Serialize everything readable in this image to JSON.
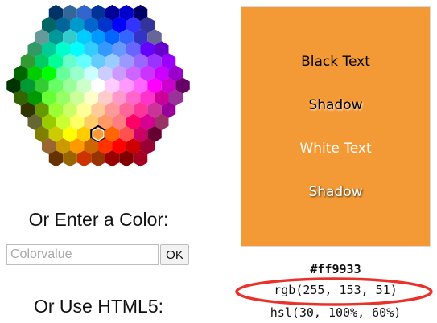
{
  "picker": {
    "selected_color": "#ff9933",
    "palette": [
      "#003366",
      "#336699",
      "#3366CC",
      "#003399",
      "#000099",
      "#0000CC",
      "#000066",
      "#006666",
      "#006699",
      "#0099CC",
      "#0066CC",
      "#0033CC",
      "#0000FF",
      "#3333FF",
      "#333399",
      "#669999",
      "#009999",
      "#33CCCC",
      "#00CCFF",
      "#0099FF",
      "#0066FF",
      "#3366FF",
      "#3333CC",
      "#666699",
      "#339966",
      "#00CC99",
      "#00FFCC",
      "#00FFFF",
      "#33CCFF",
      "#3399FF",
      "#6699FF",
      "#6666FF",
      "#6600FF",
      "#6600CC",
      "#339933",
      "#00CC66",
      "#00FF99",
      "#66FFCC",
      "#66FFFF",
      "#66CCFF",
      "#99CCFF",
      "#9999FF",
      "#9966FF",
      "#9933FF",
      "#9900FF",
      "#006600",
      "#00CC00",
      "#00FF00",
      "#66FF99",
      "#99FFCC",
      "#CCFFFF",
      "#CCCCFF",
      "#CC99FF",
      "#CC66FF",
      "#CC33FF",
      "#CC00FF",
      "#9900CC",
      "#003300",
      "#009933",
      "#33CC33",
      "#66FF66",
      "#99FF99",
      "#CCFFCC",
      "#FFFFFF",
      "#FFCCFF",
      "#FF99FF",
      "#FF66FF",
      "#FF00FF",
      "#CC00CC",
      "#660066",
      "#336600",
      "#009900",
      "#66FF33",
      "#99FF66",
      "#CCFF99",
      "#FFFFCC",
      "#FFCCCC",
      "#FF99CC",
      "#FF66CC",
      "#FF33CC",
      "#CC0099",
      "#993399",
      "#333300",
      "#669900",
      "#99FF33",
      "#CCFF66",
      "#FFFF99",
      "#FFCC99",
      "#FF9999",
      "#FF6699",
      "#FF3399",
      "#CC3399",
      "#990099",
      "#666633",
      "#99CC00",
      "#CCFF33",
      "#FFFF66",
      "#FFCC66",
      "#FF9966",
      "#FF7C80",
      "#FF0066",
      "#D60093",
      "#993366",
      "#808000",
      "#CCCC00",
      "#FFFF00",
      "#FFCC00",
      "#FF9933",
      "#FF6600",
      "#FF5050",
      "#CC0066",
      "#660033",
      "#996633",
      "#CC9900",
      "#FF9900",
      "#CC6600",
      "#FF3300",
      "#FF0000",
      "#CC0000",
      "#990033",
      "#663300",
      "#996600",
      "#CC3300",
      "#993300",
      "#990000",
      "#800000",
      "#A50021"
    ]
  },
  "form": {
    "heading": "Or Enter a Color:",
    "input_value": "",
    "input_placeholder": "Colorvalue",
    "ok_label": "OK",
    "html5_heading": "Or Use HTML5:"
  },
  "preview": {
    "background": "#f39a37",
    "black_text": "Black Text",
    "black_shadow": "Shadow",
    "white_text": "White Text",
    "white_shadow": "Shadow"
  },
  "values": {
    "hex": "#ff9933",
    "rgb": "rgb(255, 153, 51)",
    "hsl": "hsl(30, 100%, 60%)"
  },
  "annotation": {
    "color": "#e8322b"
  }
}
